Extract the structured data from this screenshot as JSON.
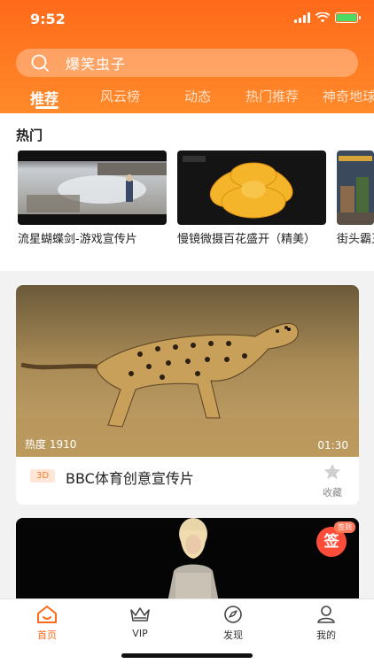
{
  "status_bar": {
    "time": "9:52"
  },
  "search": {
    "placeholder": "爆笑虫子",
    "icon": "search-icon"
  },
  "tabs": [
    {
      "label": "推荐",
      "active": true
    },
    {
      "label": "风云榜",
      "active": false
    },
    {
      "label": "动态",
      "active": false
    },
    {
      "label": "热门推荐",
      "active": false
    },
    {
      "label": "神奇地球",
      "active": false
    }
  ],
  "hot_section": {
    "title": "热门",
    "items": [
      {
        "title": "流星蝴蝶剑-游戏宣传片"
      },
      {
        "title": "慢镜微摄百花盛开（精美）"
      },
      {
        "title": "街头霸王"
      }
    ]
  },
  "feed": [
    {
      "heat": "热度 1910",
      "duration": "01:30",
      "badge": "3D",
      "title": "BBC体育创意宣传片",
      "fav_label": "收藏"
    },
    {
      "sign_label": "签",
      "sign_tag": "签到"
    }
  ],
  "tabbar": [
    {
      "label": "首页",
      "icon": "home-icon",
      "active": true
    },
    {
      "label": "VIP",
      "icon": "crown-icon",
      "active": false
    },
    {
      "label": "发现",
      "icon": "compass-icon",
      "active": false
    },
    {
      "label": "我的",
      "icon": "user-icon",
      "active": false
    }
  ],
  "colors": {
    "accent": "#ff6a1a",
    "badge_bg": "#ffe6d6",
    "sign": "#ff4d3a"
  }
}
